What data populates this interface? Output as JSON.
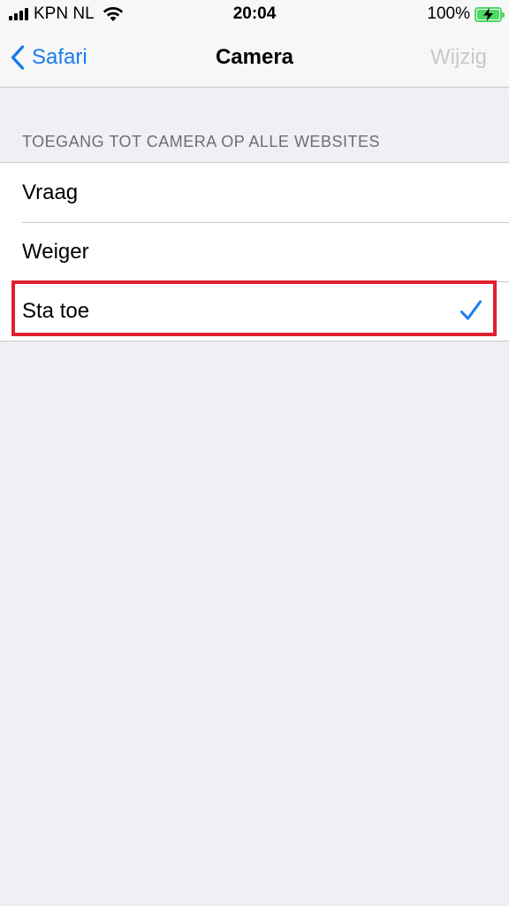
{
  "status_bar": {
    "carrier": "KPN NL",
    "time": "20:04",
    "battery_percent": "100%",
    "icons": [
      "signal-bars-icon",
      "wifi-icon",
      "battery-charging-icon"
    ]
  },
  "nav": {
    "back_label": "Safari",
    "title": "Camera",
    "edit_label": "Wijzig"
  },
  "section": {
    "header": "TOEGANG TOT CAMERA OP ALLE WEBSITES",
    "options": [
      {
        "label": "Vraag",
        "selected": false
      },
      {
        "label": "Weiger",
        "selected": false
      },
      {
        "label": "Sta toe",
        "selected": true
      }
    ]
  },
  "colors": {
    "accent": "#1a7cf0",
    "highlight_box": "#e0202e",
    "background": "#efeff4",
    "battery": "#4cd964",
    "disabled": "#c7c7cc"
  }
}
